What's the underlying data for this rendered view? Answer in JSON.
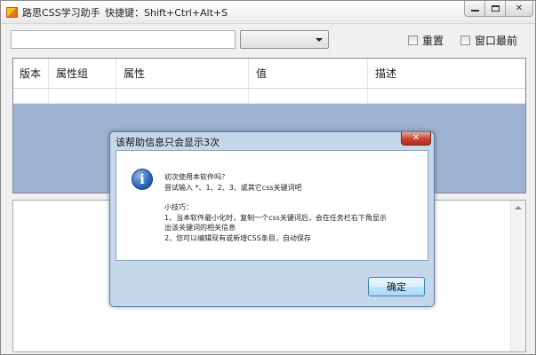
{
  "window": {
    "title": "路思CSS学习助手",
    "hotkey": "快捷键：Shift+Ctrl+Alt+S",
    "close_glyph": "✕"
  },
  "toolbar": {
    "search_value": "",
    "select_value": "",
    "reset_label": "重置",
    "topmost_label": "窗口最前"
  },
  "table": {
    "columns": [
      "版本",
      "属性组",
      "属性",
      "值",
      "描述"
    ]
  },
  "dialog": {
    "title": "该帮助信息只会显示3次",
    "close_glyph": "✕",
    "icon_glyph": "i",
    "lines": [
      "初次使用本软件吗？",
      "尝试输入 *、1、2、3、或其它css关键词吧",
      "小技巧：",
      "1、当本软件最小化时，复制一个css关键词后，会在任务栏右下角显示",
      "出该关键词的相关信息",
      "2、您可以编辑现有或新增CSS条目，自动保存"
    ],
    "ok_label": "确定"
  },
  "colors": {
    "table_fill": "#9db3d1",
    "dialog_frame": "#c5d7ea",
    "close_red": "#c74433"
  }
}
